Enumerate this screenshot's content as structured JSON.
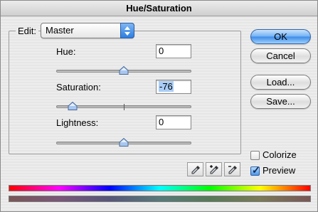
{
  "window": {
    "title": "Hue/Saturation"
  },
  "edit": {
    "label": "Edit:",
    "selected": "Master"
  },
  "hue": {
    "label": "Hue:",
    "value": "0",
    "slider_fraction": 0.5
  },
  "saturation": {
    "label": "Saturation:",
    "value": "-76",
    "slider_fraction": 0.12
  },
  "lightness": {
    "label": "Lightness:",
    "value": "0",
    "slider_fraction": 0.5
  },
  "buttons": {
    "ok": "OK",
    "cancel": "Cancel",
    "load": "Load...",
    "save": "Save..."
  },
  "options": {
    "colorize": {
      "label": "Colorize",
      "checked": false
    },
    "preview": {
      "label": "Preview",
      "checked": true
    }
  },
  "icons": [
    "eyedropper-icon",
    "eyedropper-plus-icon",
    "eyedropper-minus-icon"
  ]
}
